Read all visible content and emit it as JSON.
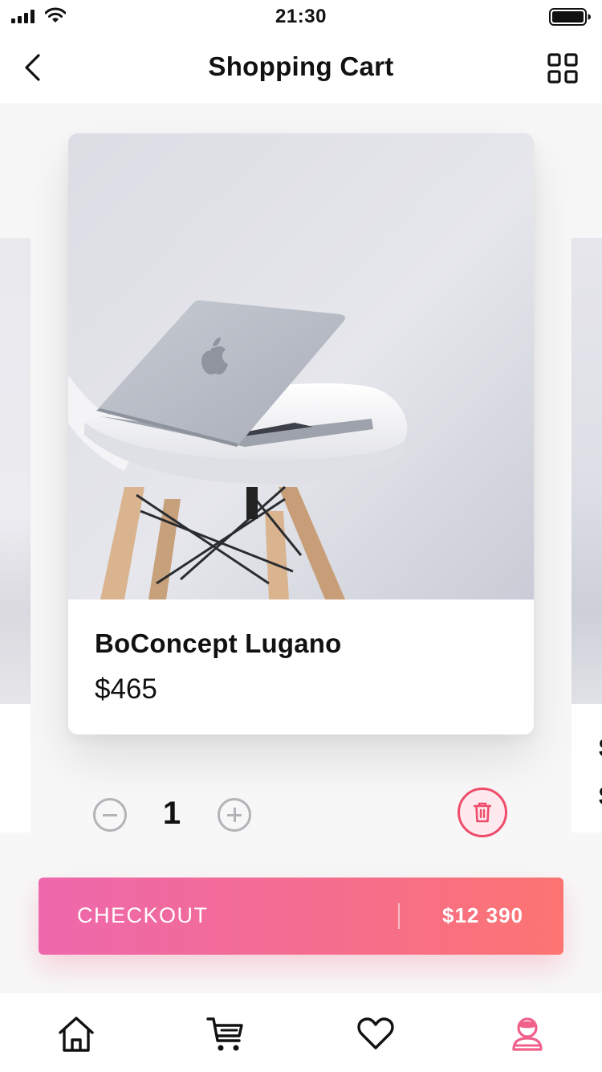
{
  "status_bar": {
    "time": "21:30"
  },
  "header": {
    "title": "Shopping Cart"
  },
  "cart": {
    "item": {
      "name": "BoConcept Lugano",
      "price": "$465",
      "quantity": "1"
    }
  },
  "peek_right": {
    "line1": "$",
    "line2": "$"
  },
  "checkout": {
    "label": "CHECKOUT",
    "total": "$12 390"
  },
  "tab_bar": {
    "items": [
      {
        "name": "home",
        "icon": "home-icon"
      },
      {
        "name": "cart",
        "icon": "cart-icon"
      },
      {
        "name": "favorites",
        "icon": "heart-icon"
      },
      {
        "name": "profile",
        "icon": "user-icon",
        "active": true
      }
    ],
    "active_color": "#f0608a"
  },
  "colors": {
    "accent_start": "#ee68ad",
    "accent_end": "#fd7472",
    "delete": "#ef4c6b"
  }
}
